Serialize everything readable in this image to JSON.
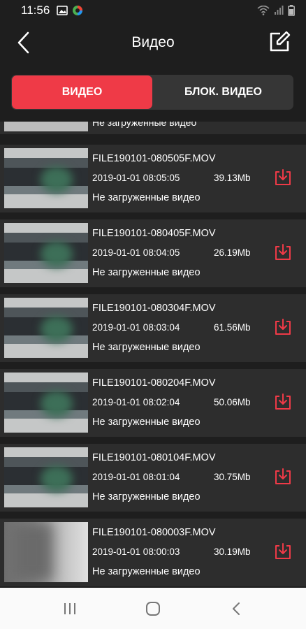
{
  "status_bar": {
    "time": "11:56"
  },
  "header": {
    "title": "Видео"
  },
  "tabs": [
    {
      "label": "ВИДЕО",
      "active": true
    },
    {
      "label": "БЛОК. ВИДЕО",
      "active": false
    }
  ],
  "partial_item": {
    "status": "Не загруженные видео"
  },
  "videos": [
    {
      "name": "FILE190101-080505F.MOV",
      "date": "2019-01-01 08:05:05",
      "size": "39.13Mb",
      "status": "Не загруженные видео"
    },
    {
      "name": "FILE190101-080405F.MOV",
      "date": "2019-01-01 08:04:05",
      "size": "26.19Mb",
      "status": "Не загруженные видео"
    },
    {
      "name": "FILE190101-080304F.MOV",
      "date": "2019-01-01 08:03:04",
      "size": "61.56Mb",
      "status": "Не загруженные видео"
    },
    {
      "name": "FILE190101-080204F.MOV",
      "date": "2019-01-01 08:02:04",
      "size": "50.06Mb",
      "status": "Не загруженные видео"
    },
    {
      "name": "FILE190101-080104F.MOV",
      "date": "2019-01-01 08:01:04",
      "size": "30.75Mb",
      "status": "Не загруженные видео"
    },
    {
      "name": "FILE190101-080003F.MOV",
      "date": "2019-01-01 08:00:03",
      "size": "30.19Mb",
      "status": "Не загруженные видео"
    }
  ],
  "colors": {
    "accent": "#ef3a47",
    "background": "#1e1e1e",
    "item_background": "#2d2d2d",
    "tab_background": "#363636"
  },
  "icons": {
    "back": "chevron-left-icon",
    "edit": "edit-icon",
    "download": "download-icon",
    "nav_recents": "recents-icon",
    "nav_home": "home-icon",
    "nav_back": "back-icon"
  }
}
